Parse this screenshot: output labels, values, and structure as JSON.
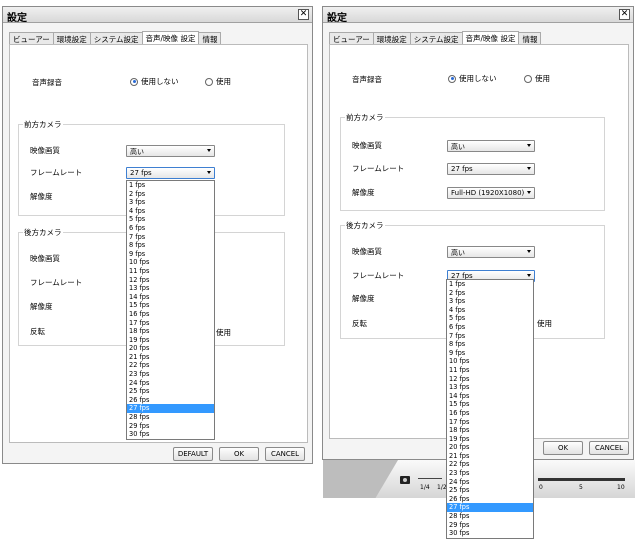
{
  "title": "設定",
  "close_glyph": "✕",
  "tabs": [
    "ビューアー",
    "環境設定",
    "システム設定",
    "音声/映像 設定",
    "情報"
  ],
  "audio": {
    "label": "音声録音",
    "opt_off": "使用しない",
    "opt_on": "使用"
  },
  "front": {
    "title": "前方カメラ",
    "quality_label": "映像画質",
    "quality": "高い",
    "fps_label": "フレームレート",
    "fps": "27 fps",
    "res_label": "解像度",
    "res": "Full-HD (1920X1080)"
  },
  "rear": {
    "title": "後方カメラ",
    "quality_label": "映像画質",
    "quality": "高い",
    "fps_label": "フレームレート",
    "fps": "27 fps",
    "res_label": "解像度",
    "flip_label": "反転",
    "flip_tail": "使用"
  },
  "fps_options": [
    "1 fps",
    "2 fps",
    "3 fps",
    "4 fps",
    "5 fps",
    "6 fps",
    "7 fps",
    "8 fps",
    "9 fps",
    "10 fps",
    "11 fps",
    "12 fps",
    "13 fps",
    "14 fps",
    "15 fps",
    "16 fps",
    "17 fps",
    "18 fps",
    "19 fps",
    "20 fps",
    "21 fps",
    "22 fps",
    "23 fps",
    "24 fps",
    "25 fps",
    "26 fps",
    "27 fps",
    "28 fps",
    "29 fps",
    "30 fps"
  ],
  "buttons": {
    "default": "DEFAULT",
    "ok": "OK",
    "cancel": "CANCEL"
  },
  "bottom": {
    "speed_ticks": [
      "1/4",
      "1/2"
    ],
    "vol_ticks": [
      "0",
      "5",
      "10"
    ]
  }
}
